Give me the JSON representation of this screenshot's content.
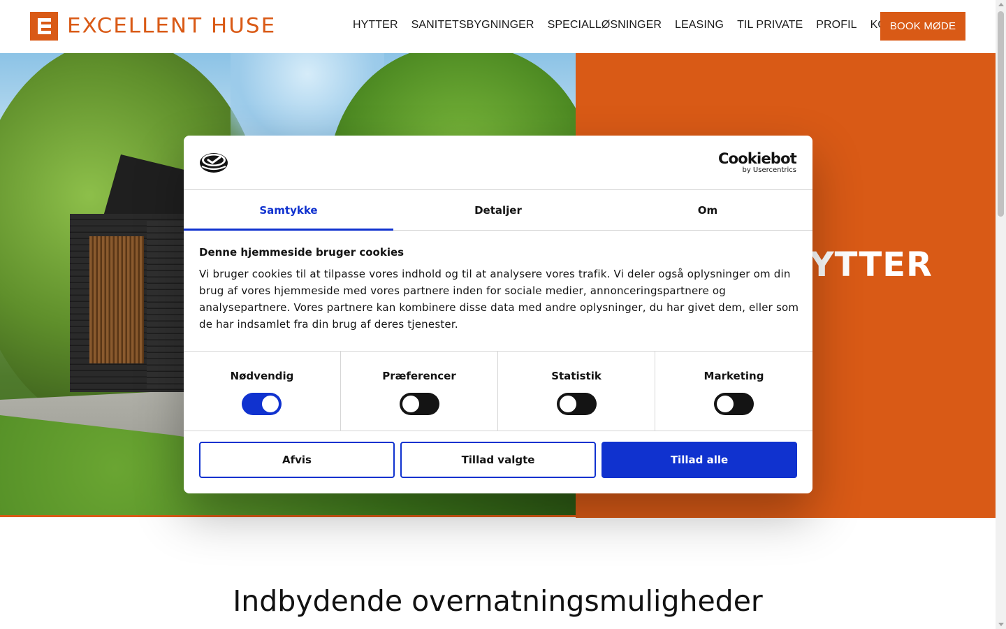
{
  "header": {
    "logo_text": "EXCELLENT HUSE",
    "nav": [
      {
        "label": "HYTTER"
      },
      {
        "label": "SANITETSBYGNINGER"
      },
      {
        "label": "SPECIALLØSNINGER"
      },
      {
        "label": "LEASING"
      },
      {
        "label": "TIL PRIVATE"
      },
      {
        "label": "PROFIL"
      },
      {
        "label": "KONTAKT"
      }
    ],
    "cta_label": "BOOK MØDE"
  },
  "hero": {
    "heading": "HYTTER",
    "photo_icon": "cabin-photo"
  },
  "section": {
    "title": "Indbydende overnatningsmuligheder"
  },
  "cookie_dialog": {
    "brand_name": "Cookiebot",
    "brand_by": "by Usercentrics",
    "tabs": [
      {
        "label": "Samtykke",
        "active": true
      },
      {
        "label": "Detaljer",
        "active": false
      },
      {
        "label": "Om",
        "active": false
      }
    ],
    "heading": "Denne hjemmeside bruger cookies",
    "body": "Vi bruger cookies til at tilpasse vores indhold og til at analysere vores trafik. Vi deler også oplysninger om din brug af vores hjemmeside med vores partnere inden for sociale medier, annonceringspartnere og analysepartnere. Vores partnere kan kombinere disse data med andre oplysninger, du har givet dem, eller som de har indsamlet fra din brug af deres tjenester.",
    "toggles": [
      {
        "label": "Nødvendig",
        "on": true
      },
      {
        "label": "Præferencer",
        "on": false
      },
      {
        "label": "Statistik",
        "on": false
      },
      {
        "label": "Marketing",
        "on": false
      }
    ],
    "buttons": {
      "reject": "Afvis",
      "allow_selected": "Tillad valgte",
      "allow_all": "Tillad alle"
    }
  },
  "colors": {
    "brand_orange": "#d95a16",
    "cookie_blue": "#1032cf",
    "text_dark": "#141414"
  }
}
